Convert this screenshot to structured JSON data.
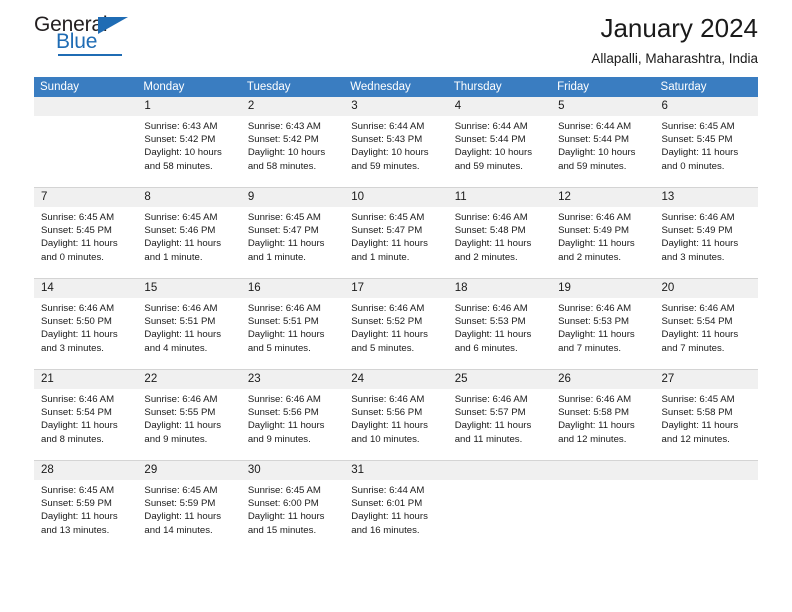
{
  "brand": {
    "name_part1": "General",
    "name_part2": "Blue",
    "accent_color": "#1f6cb4"
  },
  "header": {
    "title": "January 2024",
    "subtitle": "Allapalli, Maharashtra, India"
  },
  "calendar": {
    "header_bg": "#3a7dc1",
    "daynum_bg": "#f0f0f0",
    "weekday_headers": [
      "Sunday",
      "Monday",
      "Tuesday",
      "Wednesday",
      "Thursday",
      "Friday",
      "Saturday"
    ],
    "labels": {
      "sunrise_prefix": "Sunrise:",
      "sunset_prefix": "Sunset:",
      "daylight_prefix": "Daylight:"
    },
    "weeks": [
      [
        {
          "day": "",
          "blank": true,
          "sunrise": "",
          "sunset": "",
          "daylight_line1": "",
          "daylight_line2": ""
        },
        {
          "day": "1",
          "sunrise": "Sunrise: 6:43 AM",
          "sunset": "Sunset: 5:42 PM",
          "daylight_line1": "Daylight: 10 hours",
          "daylight_line2": "and 58 minutes."
        },
        {
          "day": "2",
          "sunrise": "Sunrise: 6:43 AM",
          "sunset": "Sunset: 5:42 PM",
          "daylight_line1": "Daylight: 10 hours",
          "daylight_line2": "and 58 minutes."
        },
        {
          "day": "3",
          "sunrise": "Sunrise: 6:44 AM",
          "sunset": "Sunset: 5:43 PM",
          "daylight_line1": "Daylight: 10 hours",
          "daylight_line2": "and 59 minutes."
        },
        {
          "day": "4",
          "sunrise": "Sunrise: 6:44 AM",
          "sunset": "Sunset: 5:44 PM",
          "daylight_line1": "Daylight: 10 hours",
          "daylight_line2": "and 59 minutes."
        },
        {
          "day": "5",
          "sunrise": "Sunrise: 6:44 AM",
          "sunset": "Sunset: 5:44 PM",
          "daylight_line1": "Daylight: 10 hours",
          "daylight_line2": "and 59 minutes."
        },
        {
          "day": "6",
          "sunrise": "Sunrise: 6:45 AM",
          "sunset": "Sunset: 5:45 PM",
          "daylight_line1": "Daylight: 11 hours",
          "daylight_line2": "and 0 minutes."
        }
      ],
      [
        {
          "day": "7",
          "sunrise": "Sunrise: 6:45 AM",
          "sunset": "Sunset: 5:45 PM",
          "daylight_line1": "Daylight: 11 hours",
          "daylight_line2": "and 0 minutes."
        },
        {
          "day": "8",
          "sunrise": "Sunrise: 6:45 AM",
          "sunset": "Sunset: 5:46 PM",
          "daylight_line1": "Daylight: 11 hours",
          "daylight_line2": "and 1 minute."
        },
        {
          "day": "9",
          "sunrise": "Sunrise: 6:45 AM",
          "sunset": "Sunset: 5:47 PM",
          "daylight_line1": "Daylight: 11 hours",
          "daylight_line2": "and 1 minute."
        },
        {
          "day": "10",
          "sunrise": "Sunrise: 6:45 AM",
          "sunset": "Sunset: 5:47 PM",
          "daylight_line1": "Daylight: 11 hours",
          "daylight_line2": "and 1 minute."
        },
        {
          "day": "11",
          "sunrise": "Sunrise: 6:46 AM",
          "sunset": "Sunset: 5:48 PM",
          "daylight_line1": "Daylight: 11 hours",
          "daylight_line2": "and 2 minutes."
        },
        {
          "day": "12",
          "sunrise": "Sunrise: 6:46 AM",
          "sunset": "Sunset: 5:49 PM",
          "daylight_line1": "Daylight: 11 hours",
          "daylight_line2": "and 2 minutes."
        },
        {
          "day": "13",
          "sunrise": "Sunrise: 6:46 AM",
          "sunset": "Sunset: 5:49 PM",
          "daylight_line1": "Daylight: 11 hours",
          "daylight_line2": "and 3 minutes."
        }
      ],
      [
        {
          "day": "14",
          "sunrise": "Sunrise: 6:46 AM",
          "sunset": "Sunset: 5:50 PM",
          "daylight_line1": "Daylight: 11 hours",
          "daylight_line2": "and 3 minutes."
        },
        {
          "day": "15",
          "sunrise": "Sunrise: 6:46 AM",
          "sunset": "Sunset: 5:51 PM",
          "daylight_line1": "Daylight: 11 hours",
          "daylight_line2": "and 4 minutes."
        },
        {
          "day": "16",
          "sunrise": "Sunrise: 6:46 AM",
          "sunset": "Sunset: 5:51 PM",
          "daylight_line1": "Daylight: 11 hours",
          "daylight_line2": "and 5 minutes."
        },
        {
          "day": "17",
          "sunrise": "Sunrise: 6:46 AM",
          "sunset": "Sunset: 5:52 PM",
          "daylight_line1": "Daylight: 11 hours",
          "daylight_line2": "and 5 minutes."
        },
        {
          "day": "18",
          "sunrise": "Sunrise: 6:46 AM",
          "sunset": "Sunset: 5:53 PM",
          "daylight_line1": "Daylight: 11 hours",
          "daylight_line2": "and 6 minutes."
        },
        {
          "day": "19",
          "sunrise": "Sunrise: 6:46 AM",
          "sunset": "Sunset: 5:53 PM",
          "daylight_line1": "Daylight: 11 hours",
          "daylight_line2": "and 7 minutes."
        },
        {
          "day": "20",
          "sunrise": "Sunrise: 6:46 AM",
          "sunset": "Sunset: 5:54 PM",
          "daylight_line1": "Daylight: 11 hours",
          "daylight_line2": "and 7 minutes."
        }
      ],
      [
        {
          "day": "21",
          "sunrise": "Sunrise: 6:46 AM",
          "sunset": "Sunset: 5:54 PM",
          "daylight_line1": "Daylight: 11 hours",
          "daylight_line2": "and 8 minutes."
        },
        {
          "day": "22",
          "sunrise": "Sunrise: 6:46 AM",
          "sunset": "Sunset: 5:55 PM",
          "daylight_line1": "Daylight: 11 hours",
          "daylight_line2": "and 9 minutes."
        },
        {
          "day": "23",
          "sunrise": "Sunrise: 6:46 AM",
          "sunset": "Sunset: 5:56 PM",
          "daylight_line1": "Daylight: 11 hours",
          "daylight_line2": "and 9 minutes."
        },
        {
          "day": "24",
          "sunrise": "Sunrise: 6:46 AM",
          "sunset": "Sunset: 5:56 PM",
          "daylight_line1": "Daylight: 11 hours",
          "daylight_line2": "and 10 minutes."
        },
        {
          "day": "25",
          "sunrise": "Sunrise: 6:46 AM",
          "sunset": "Sunset: 5:57 PM",
          "daylight_line1": "Daylight: 11 hours",
          "daylight_line2": "and 11 minutes."
        },
        {
          "day": "26",
          "sunrise": "Sunrise: 6:46 AM",
          "sunset": "Sunset: 5:58 PM",
          "daylight_line1": "Daylight: 11 hours",
          "daylight_line2": "and 12 minutes."
        },
        {
          "day": "27",
          "sunrise": "Sunrise: 6:45 AM",
          "sunset": "Sunset: 5:58 PM",
          "daylight_line1": "Daylight: 11 hours",
          "daylight_line2": "and 12 minutes."
        }
      ],
      [
        {
          "day": "28",
          "sunrise": "Sunrise: 6:45 AM",
          "sunset": "Sunset: 5:59 PM",
          "daylight_line1": "Daylight: 11 hours",
          "daylight_line2": "and 13 minutes."
        },
        {
          "day": "29",
          "sunrise": "Sunrise: 6:45 AM",
          "sunset": "Sunset: 5:59 PM",
          "daylight_line1": "Daylight: 11 hours",
          "daylight_line2": "and 14 minutes."
        },
        {
          "day": "30",
          "sunrise": "Sunrise: 6:45 AM",
          "sunset": "Sunset: 6:00 PM",
          "daylight_line1": "Daylight: 11 hours",
          "daylight_line2": "and 15 minutes."
        },
        {
          "day": "31",
          "sunrise": "Sunrise: 6:44 AM",
          "sunset": "Sunset: 6:01 PM",
          "daylight_line1": "Daylight: 11 hours",
          "daylight_line2": "and 16 minutes."
        },
        {
          "day": "",
          "blank": true,
          "sunrise": "",
          "sunset": "",
          "daylight_line1": "",
          "daylight_line2": ""
        },
        {
          "day": "",
          "blank": true,
          "sunrise": "",
          "sunset": "",
          "daylight_line1": "",
          "daylight_line2": ""
        },
        {
          "day": "",
          "blank": true,
          "sunrise": "",
          "sunset": "",
          "daylight_line1": "",
          "daylight_line2": ""
        }
      ]
    ]
  }
}
